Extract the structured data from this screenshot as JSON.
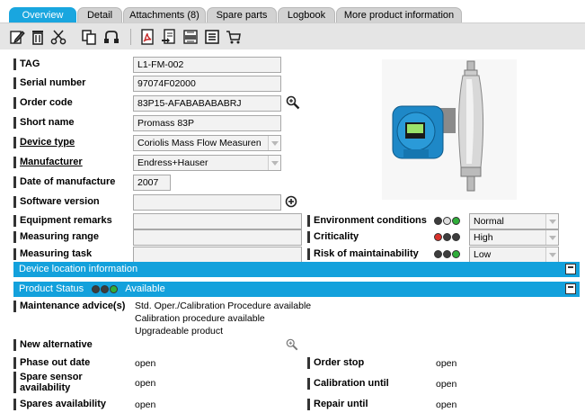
{
  "tabs": [
    {
      "label": "Overview",
      "active": true
    },
    {
      "label": "Detail"
    },
    {
      "label": "Attachments (8)"
    },
    {
      "label": "Spare parts"
    },
    {
      "label": "Logbook"
    },
    {
      "label": "More product information"
    }
  ],
  "toolbar": {
    "icons": [
      "edit-icon",
      "delete-icon",
      "cut-icon",
      "copy-icon",
      "link-icon",
      "pdf-icon",
      "export-icon",
      "xml-icon",
      "list-icon",
      "cart-icon"
    ]
  },
  "fields": {
    "tag": {
      "label": "TAG",
      "value": "L1-FM-002"
    },
    "serial": {
      "label": "Serial number",
      "value": "97074F02000"
    },
    "order_code": {
      "label": "Order code",
      "value": "83P15-AFABABABABRJ"
    },
    "short_name": {
      "label": "Short name",
      "value": "Promass 83P"
    },
    "device_type": {
      "label": "Device type",
      "value": "Coriolis Mass Flow Measuren"
    },
    "manufacturer": {
      "label": "Manufacturer",
      "value": "Endress+Hauser"
    },
    "date_manufacture": {
      "label": "Date of manufacture",
      "value": "2007"
    },
    "software_version": {
      "label": "Software version",
      "value": ""
    },
    "equipment_remarks": {
      "label": "Equipment remarks",
      "value": ""
    },
    "measuring_range": {
      "label": "Measuring range",
      "value": ""
    },
    "measuring_task": {
      "label": "Measuring task",
      "value": ""
    }
  },
  "ratings": {
    "environment": {
      "label": "Environment conditions",
      "value": "Normal"
    },
    "criticality": {
      "label": "Criticality",
      "value": "High"
    },
    "risk": {
      "label": "Risk of maintainability",
      "value": "Low"
    }
  },
  "device_location": {
    "label": "Device location information"
  },
  "product_status": {
    "label": "Product Status",
    "value": "Available",
    "maintenance_label": "Maintenance advice(s)",
    "maintenance_lines": [
      "Std. Oper./Calibration Procedure available",
      "Calibration procedure available",
      "Upgradeable product"
    ],
    "new_alternative_label": "New alternative",
    "phase_out_label": "Phase out date",
    "phase_out_value": "open",
    "order_stop_label": "Order stop",
    "order_stop_value": "open",
    "spare_sensor_label": "Spare sensor availability",
    "spare_sensor_value": "open",
    "calibration_label": "Calibration until",
    "calibration_value": "open",
    "spares_label": "Spares availability",
    "spares_value": "open",
    "repair_label": "Repair until",
    "repair_value": "open"
  },
  "colors": {
    "accent": "#13a1dc",
    "status_green": "#2fae3a",
    "status_red": "#d9322b",
    "status_grey": "#d0d0d0",
    "tab_inactive": "#d2d2d2",
    "toolbar_bg": "#e5e5e5"
  }
}
